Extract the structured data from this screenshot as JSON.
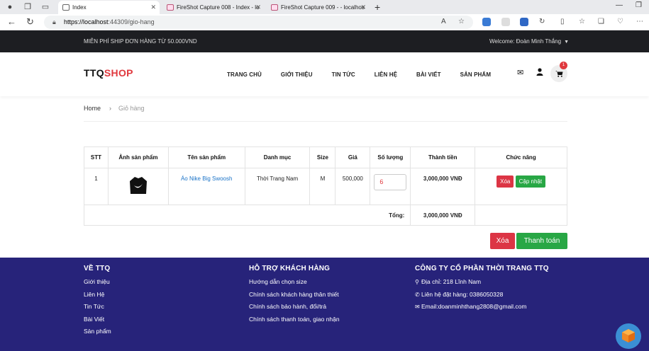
{
  "browser": {
    "tabs": [
      {
        "title": "Index",
        "active": true
      },
      {
        "title": "FireShot Capture 008 - Index - lo",
        "active": false
      },
      {
        "title": "FireShot Capture 009 - - localhos",
        "active": false
      }
    ],
    "url_host": "https://localhost",
    "url_path": ":44309/gio-hang"
  },
  "topbar": {
    "promo": "MIỄN PHÍ SHIP ĐƠN HÀNG TỪ 50.000VND",
    "welcome": "Welcome: Đoàn Minh Thắng"
  },
  "header": {
    "logo_part1": "TTQ",
    "logo_part2": "SHOP",
    "menu": [
      "TRANG CHỦ",
      "GIỚI THIỆU",
      "TIN TỨC",
      "LIÊN HỆ",
      "BÀI VIẾT",
      "SẢN PHẨM"
    ],
    "cart_count": "1"
  },
  "breadcrumb": {
    "home": "Home",
    "current": "Giỏ hàng"
  },
  "cart": {
    "headers": [
      "STT",
      "Ảnh sản phẩm",
      "Tên sản phẩm",
      "Danh mục",
      "Size",
      "Giá",
      "Số lượng",
      "Thành tiền",
      "Chức năng"
    ],
    "row": {
      "stt": "1",
      "name": "Áo Nike Big Swoosh",
      "category": "Thời Trang Nam",
      "size": "M",
      "price": "500,000",
      "quantity": "6",
      "subtotal": "3,000,000 VNĐ",
      "delete_label": "Xóa",
      "update_label": "Cập nhật"
    },
    "total_label": "Tổng:",
    "total_value": "3,000,000 VNĐ",
    "delete_all_label": "Xóa",
    "checkout_label": "Thanh toán"
  },
  "footer": {
    "col1": {
      "title": "VỀ TTQ",
      "items": [
        "Giới thiệu",
        "Liên Hệ",
        "Tin Tức",
        "Bài Viết",
        "Sản phẩm"
      ]
    },
    "col2": {
      "title": "HỖ TRỢ KHÁCH HÀNG",
      "items": [
        "Hướng dẫn chọn size",
        "Chính sách khách hàng thân thiết",
        "Chính sách bảo hành, đổi/trả",
        "Chính sách thanh toán, giao nhận"
      ]
    },
    "col3": {
      "title": "CÔNG TY CỔ PHẦN THỜI TRANG TTQ",
      "items": [
        "Địa chỉ: 218 Lĩnh Nam",
        "Liên hệ đặt hàng: 0386050328",
        "Email:doanminhthang2808@gmail.com"
      ]
    }
  },
  "colors": {
    "accent": "#e0393e",
    "footer_bg": "#27237a",
    "topbar_bg": "#1d1e22",
    "danger": "#dc3545",
    "success": "#28a745"
  }
}
